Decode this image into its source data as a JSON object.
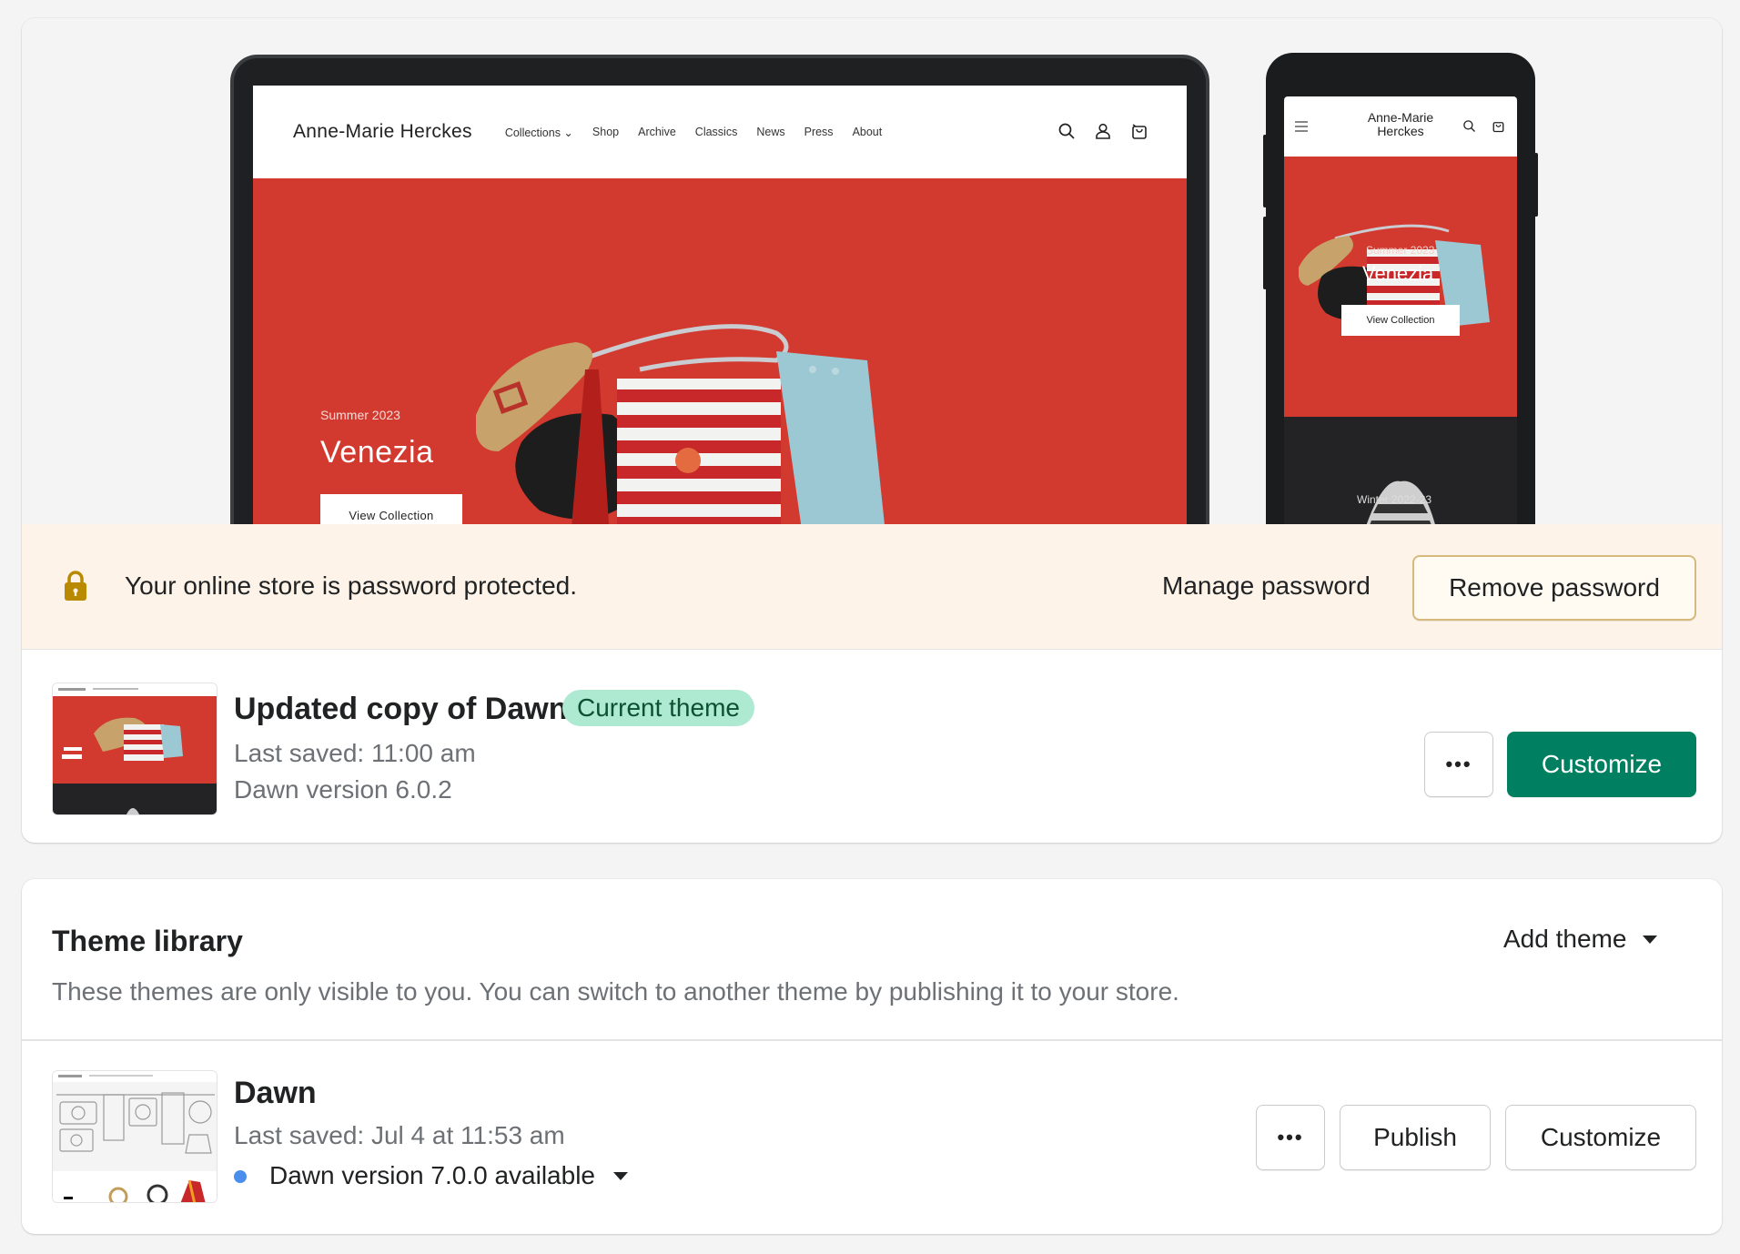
{
  "preview": {
    "desktop": {
      "store_name": "Anne-Marie Herckes",
      "nav": [
        "Collections",
        "Shop",
        "Archive",
        "Classics",
        "News",
        "Press",
        "About"
      ],
      "hero_subtitle": "Summer 2023",
      "hero_title": "Venezia",
      "hero_button": "View Collection"
    },
    "mobile": {
      "store_name": "Anne-Marie Herckes",
      "hero_subtitle": "Summer 2023",
      "hero_title": "Venezia",
      "hero_button": "View Collection",
      "second_collection": "Winter 2022-23"
    }
  },
  "password_banner": {
    "message": "Your online store is password protected.",
    "manage_label": "Manage password",
    "remove_label": "Remove password"
  },
  "current_theme": {
    "name": "Updated copy of Dawn",
    "badge": "Current theme",
    "last_saved": "Last saved: 11:00 am",
    "version": "Dawn version 6.0.2",
    "more_label": "•••",
    "customize_label": "Customize"
  },
  "library": {
    "title": "Theme library",
    "add_theme_label": "Add theme",
    "description": "These themes are only visible to you. You can switch to another theme by publishing it to your store.",
    "themes": [
      {
        "name": "Dawn",
        "last_saved": "Last saved: Jul 4 at 11:53 am",
        "update_notice": "Dawn version 7.0.0 available",
        "more_label": "•••",
        "publish_label": "Publish",
        "customize_label": "Customize"
      }
    ]
  },
  "colors": {
    "primary_green": "#008060",
    "badge_bg": "#aee9d1",
    "banner_bg": "#fdf3e8",
    "hero_red": "#d33a2f",
    "update_dot": "#4a8ded"
  }
}
